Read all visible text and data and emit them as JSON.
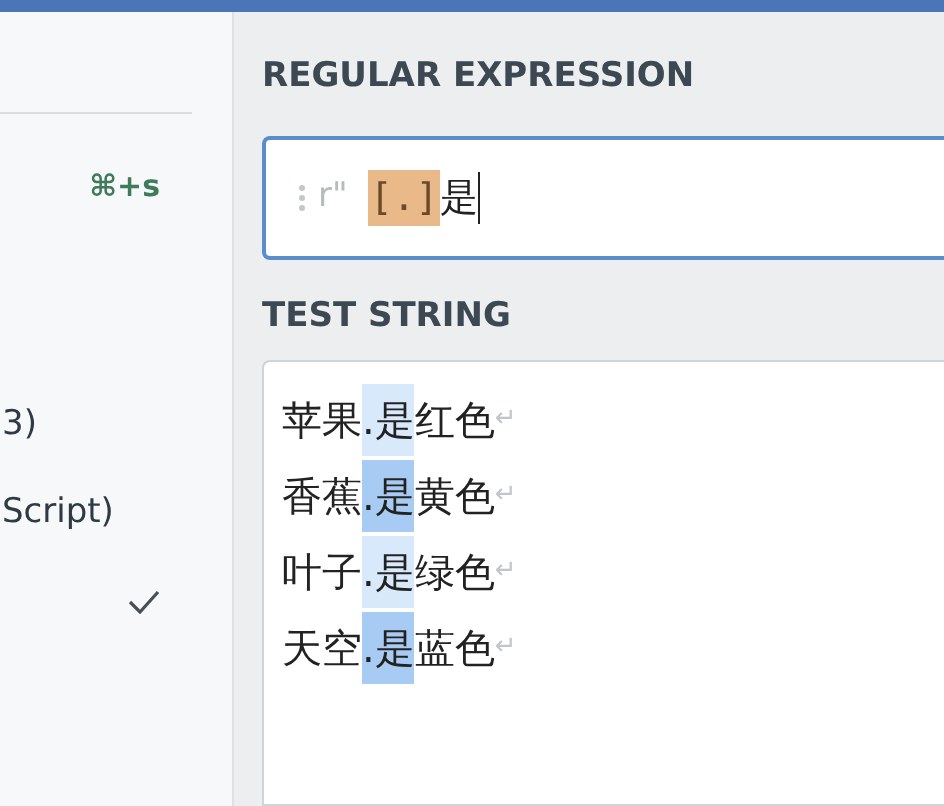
{
  "sidebar": {
    "shortcut": "⌘+s",
    "flavors": [
      {
        "label": "3)",
        "selected": false
      },
      {
        "label": "Script)",
        "selected": false
      },
      {
        "selected": true
      }
    ]
  },
  "regex": {
    "title": "REGULAR EXPRESSION",
    "delimiter": "r\"",
    "tokens": [
      {
        "kind": "class",
        "text": "[.]"
      },
      {
        "kind": "literal",
        "text": "是"
      }
    ]
  },
  "test_string": {
    "title": "TEST STRING",
    "lines": [
      {
        "before": "苹果",
        "match": ".是",
        "after": "红色",
        "eol": "↵",
        "color": "#d9e9fc"
      },
      {
        "before": "香蕉",
        "match": ".是",
        "after": "黄色",
        "eol": "↵",
        "color": "#a8cbf3"
      },
      {
        "before": "叶子",
        "match": ".是",
        "after": "绿色",
        "eol": "↵",
        "color": "#d9e9fc"
      },
      {
        "before": "天空",
        "match": ".是",
        "after": "蓝色",
        "eol": "↵",
        "color": "#a8cbf3"
      }
    ]
  }
}
